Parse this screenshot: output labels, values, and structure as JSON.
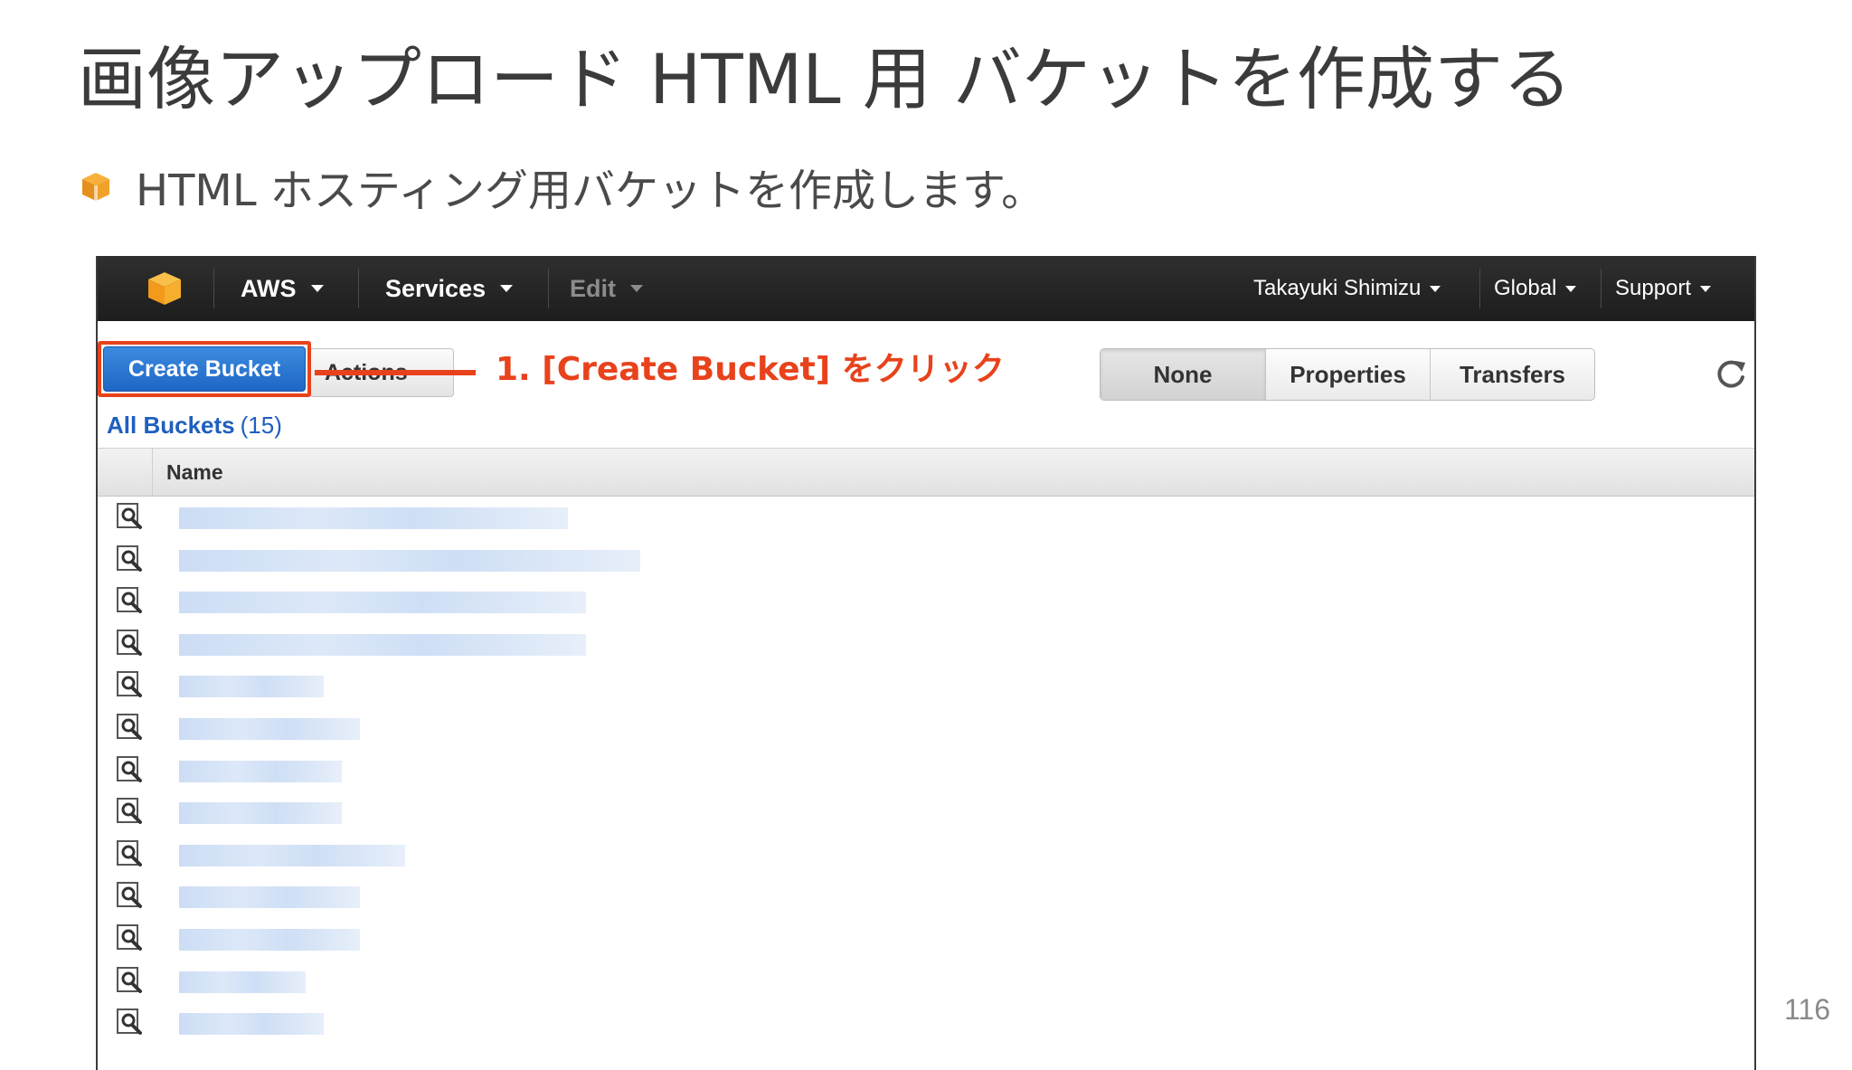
{
  "slide": {
    "title": "画像アップロード HTML 用 バケットを作成する",
    "bullet": "HTML ホスティング用バケットを作成します。",
    "page_number": "116"
  },
  "console": {
    "nav": {
      "brand": "AWS",
      "services": "Services",
      "edit": "Edit",
      "user": "Takayuki Shimizu",
      "region": "Global",
      "support": "Support"
    },
    "toolbar": {
      "create_bucket": "Create Bucket",
      "actions": "Actions",
      "view_tabs": [
        "None",
        "Properties",
        "Transfers"
      ]
    },
    "annotation": "1. [Create Bucket] をクリック",
    "bucket_list": {
      "label": "All Buckets",
      "count": "(15)",
      "column_name": "Name",
      "visible_row_count": 13
    }
  },
  "colors": {
    "annotation": "#e8421c",
    "primary_button": "#2a75d3",
    "nav_background": "#232323",
    "link": "#1f5fbf"
  }
}
